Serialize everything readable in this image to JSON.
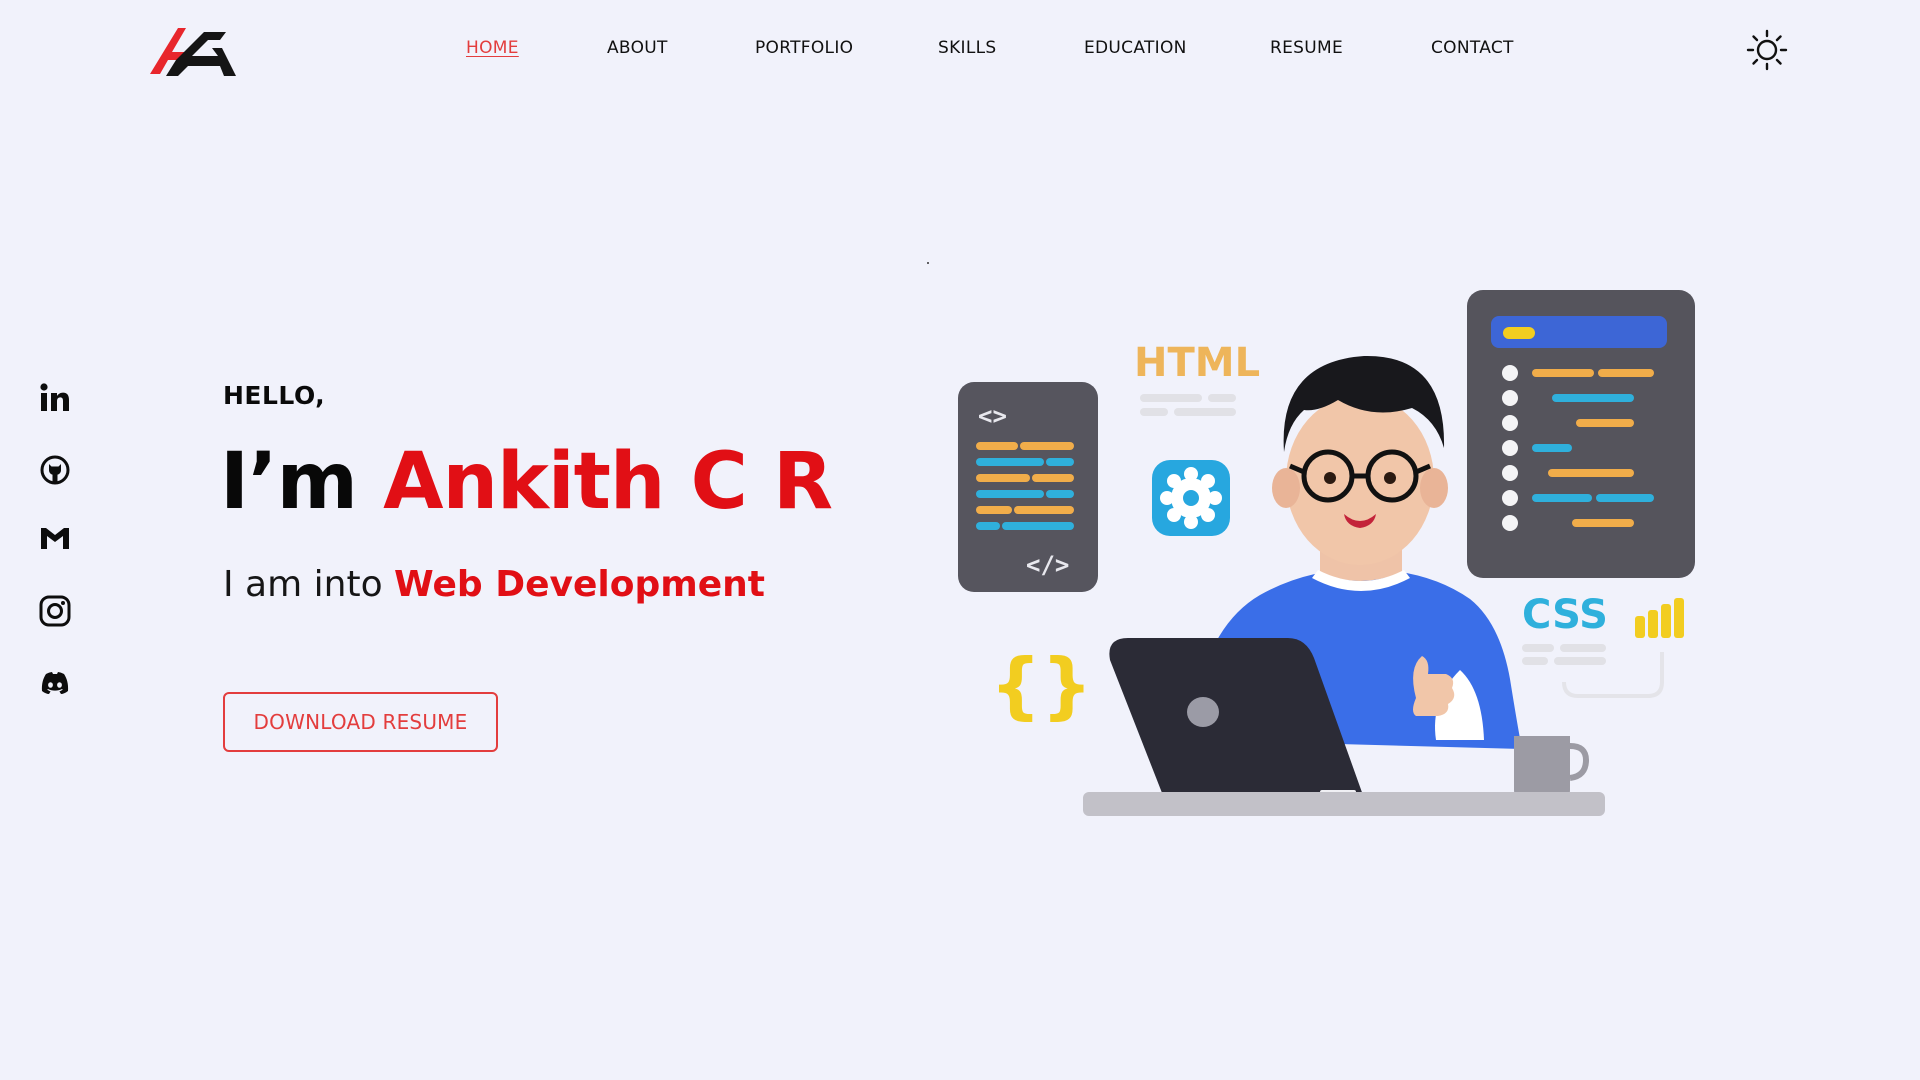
{
  "header": {
    "nav": [
      {
        "label": "HOME",
        "active": true
      },
      {
        "label": "ABOUT",
        "active": false
      },
      {
        "label": "PORTFOLIO",
        "active": false
      },
      {
        "label": "SKILLS",
        "active": false
      },
      {
        "label": "EDUCATION",
        "active": false
      },
      {
        "label": "RESUME",
        "active": false
      },
      {
        "label": "CONTACT",
        "active": false
      }
    ],
    "theme_icon": "sun-icon"
  },
  "social": [
    {
      "icon": "linkedin-icon"
    },
    {
      "icon": "github-icon"
    },
    {
      "icon": "gmail-icon"
    },
    {
      "icon": "instagram-icon"
    },
    {
      "icon": "discord-icon"
    }
  ],
  "hero": {
    "greeting": "HELLO,",
    "lead": "I’m ",
    "name": "Ankith C R",
    "subtitle_prefix": "I am into ",
    "role": "Web Development",
    "download_label": "DOWNLOAD RESUME"
  },
  "illustration": {
    "html_label": "HTML",
    "css_label": "CSS",
    "code_open_tag": "<>",
    "code_close_tag": "</>",
    "braces": "{}"
  },
  "colors": {
    "accent": "#e10f15",
    "background": "#f1f2fb",
    "button_border": "#e33d3d"
  }
}
